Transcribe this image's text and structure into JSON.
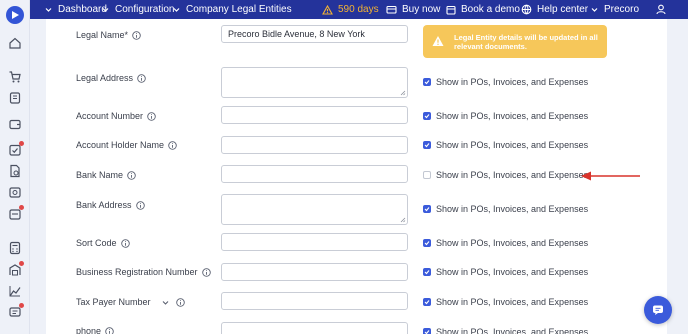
{
  "topbar": {
    "dashboard": "Dashboard",
    "configuration": "Configuration",
    "company_legal_entities": "Company Legal Entities",
    "days_left": "590 days",
    "buy_now": "Buy now",
    "book_demo": "Book a demo",
    "help_center": "Help center",
    "company": "Precoro"
  },
  "alert": {
    "text": "Legal Entity details will be updated in all relevant documents."
  },
  "form": {
    "legal_name_label": "Legal Name*",
    "legal_name_value": "Precoro Bidle Avenue, 8 New York",
    "legal_address_label": "Legal Address",
    "account_number_label": "Account Number",
    "account_holder_label": "Account Holder Name",
    "bank_name_label": "Bank Name",
    "bank_address_label": "Bank Address",
    "sort_code_label": "Sort Code",
    "business_reg_label": "Business Registration Number",
    "tax_payer_label": "Tax Payer Number",
    "phone_label": "phone",
    "show_in_docs": "Show in POs, Invoices, and Expenses"
  },
  "checkboxes": {
    "legal_address": true,
    "account_number": true,
    "account_holder": true,
    "bank_name": false,
    "bank_address": true,
    "sort_code": true,
    "business_reg": true,
    "tax_payer": true,
    "phone": true
  },
  "colors": {
    "topbar": "#24339b",
    "accent": "#3b5bdb",
    "alert": "#f6c75a",
    "arrow": "#d9332b",
    "warning_text": "#f2b233"
  },
  "icons": [
    "logo-icon",
    "home-icon",
    "warning-icon",
    "cart-icon",
    "calendar-icon",
    "globe-icon",
    "user-icon",
    "chat-icon",
    "info-icon",
    "chevron-down-icon"
  ]
}
